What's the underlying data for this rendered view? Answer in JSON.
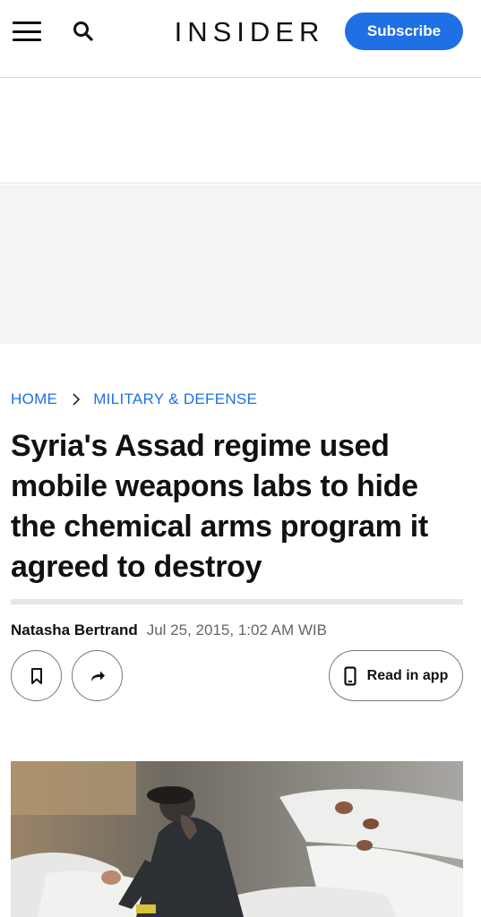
{
  "header": {
    "logo": "INSIDER",
    "subscribe_label": "Subscribe",
    "menu_icon": "hamburger-menu-icon",
    "search_icon": "search-icon"
  },
  "breadcrumb": {
    "home": "HOME",
    "section": "MILITARY & DEFENSE",
    "separator_icon": "chevron-right-icon"
  },
  "article": {
    "headline": "Syria's Assad regime used mobile weapons labs to hide the chemical arms program it agreed to destroy",
    "author": "Natasha Bertrand",
    "date": "Jul 25, 2015, 1:02 AM WIB"
  },
  "actions": {
    "bookmark_icon": "bookmark-icon",
    "share_icon": "share-arrow-icon",
    "read_in_app_label": "Read in app",
    "phone_icon": "phone-icon"
  },
  "colors": {
    "accent": "#1f6fe5",
    "text": "#111111",
    "muted": "#666666",
    "ad_background": "#f4f4f4"
  }
}
